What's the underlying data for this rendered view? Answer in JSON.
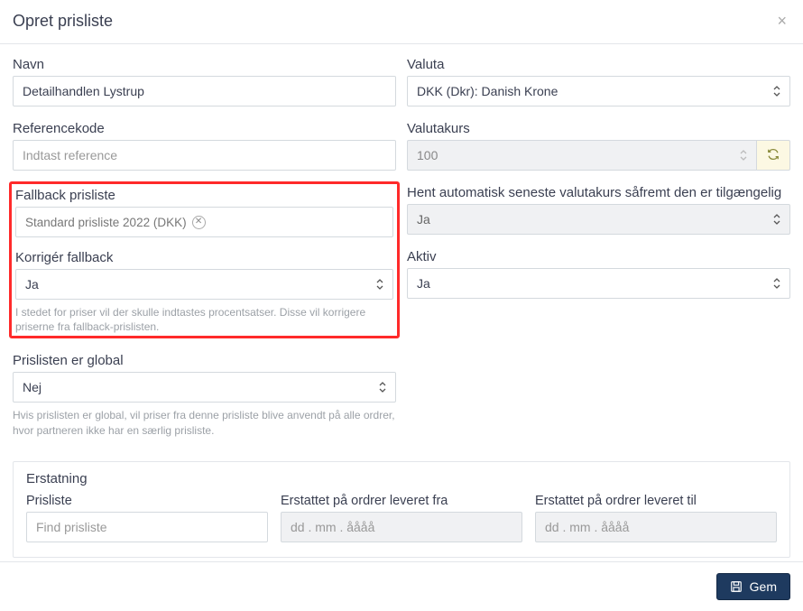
{
  "header": {
    "title": "Opret prisliste"
  },
  "left": {
    "name_label": "Navn",
    "name_value": "Detailhandlen Lystrup",
    "ref_label": "Referencekode",
    "ref_placeholder": "Indtast reference",
    "fallback_label": "Fallback prisliste",
    "fallback_chip": "Standard prisliste 2022 (DKK)",
    "correct_label": "Korrigér fallback",
    "correct_value": "Ja",
    "correct_hint": "I stedet for priser vil der skulle indtastes procentsatser. Disse vil korrigere priserne fra fallback-prislisten.",
    "global_label": "Prislisten er global",
    "global_value": "Nej",
    "global_hint": "Hvis prislisten er global, vil priser fra denne prisliste blive anvendt på alle ordrer, hvor partneren ikke har en særlig prisliste."
  },
  "right": {
    "currency_label": "Valuta",
    "currency_value": "DKK (Dkr): Danish Krone",
    "rate_label": "Valutakurs",
    "rate_value": "100",
    "autorate_label": "Hent automatisk seneste valutakurs såfremt den er tilgængelig",
    "autorate_value": "Ja",
    "active_label": "Aktiv",
    "active_value": "Ja"
  },
  "replacement": {
    "panel_title": "Erstatning",
    "pricelist_label": "Prisliste",
    "pricelist_placeholder": "Find prisliste",
    "from_label": "Erstattet på ordrer leveret fra",
    "to_label": "Erstattet på ordrer leveret til",
    "date_placeholder": "dd . mm . åååå"
  },
  "footer": {
    "save_label": "Gem"
  }
}
